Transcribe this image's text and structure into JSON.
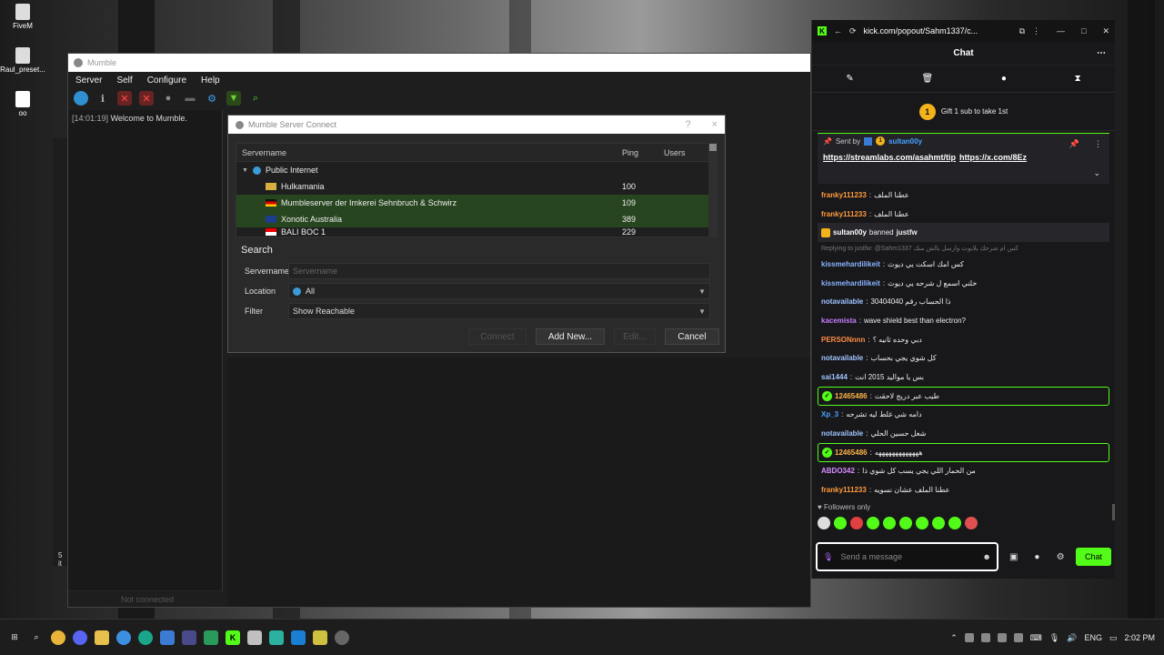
{
  "desktop": {
    "icons": [
      {
        "label": "FiveM"
      },
      {
        "label": "Raul_preset..."
      },
      {
        "label": "oo"
      }
    ]
  },
  "mumble": {
    "title": "Mumble",
    "menu": [
      "Server",
      "Self",
      "Configure",
      "Help"
    ],
    "log": {
      "timestamp": "[14:01:19]",
      "text": "Welcome to Mumble."
    },
    "status": "Not connected"
  },
  "connect_dialog": {
    "title": "Mumble Server Connect",
    "help": "?",
    "close": "×",
    "columns": {
      "name": "Servername",
      "ping": "Ping",
      "users": "Users"
    },
    "group": "Public Internet",
    "servers": [
      {
        "name": "Hulkamania",
        "ping": "100",
        "flag": "#d8b040",
        "selected": false
      },
      {
        "name": "Mumbleserver der Imkerei Sehnbruch & Schwirz",
        "ping": "109",
        "flag": "#d00000",
        "selected": true
      },
      {
        "name": "Xonotic Australia",
        "ping": "389",
        "flag": "#1c3d8c",
        "selected": true
      },
      {
        "name": "BALI BOC 1",
        "ping": "229",
        "flag": "#e00000",
        "selected": false
      }
    ],
    "search": {
      "title": "Search",
      "servername_label": "Servername",
      "servername_placeholder": "Servername",
      "location_label": "Location",
      "location_value": "All",
      "filter_label": "Filter",
      "filter_value": "Show Reachable"
    },
    "buttons": {
      "connect": "Connect",
      "add_new": "Add New...",
      "edit": "Edit...",
      "cancel": "Cancel"
    }
  },
  "left_strip": {
    "text": "5 it"
  },
  "chat": {
    "url": "kick.com/popout/Sahm1337/c...",
    "title": "Chat",
    "more": "⋯",
    "gift_text": "Gift 1 sub to take 1st",
    "gift_coin": "1",
    "pinned": {
      "sent_by_label": "Sent by",
      "sender": "sultan00y",
      "links": [
        "https://streamlabs.com/asahmt/tip",
        "https://x.com/8Ez"
      ]
    },
    "messages": [
      {
        "user": "franky111233",
        "color": "#ff9a3c",
        "text": "عطنا الملف",
        "type": "normal"
      },
      {
        "user": "franky111233",
        "color": "#ff9a3c",
        "text": "عطنا الملف",
        "type": "normal"
      },
      {
        "user": "sultan00y",
        "color": "#ffffff",
        "text": "banned",
        "target": "justfw",
        "type": "system"
      },
      {
        "user": "",
        "color": "#777777",
        "text": "Replying to justfw: @Sahm1337 كس ام شرحك يلايوت وارسل بالش منك",
        "type": "reply"
      },
      {
        "user": "kissmehardilikeit",
        "color": "#8ab4ff",
        "text": "كس امك اسكت يي ديوث",
        "type": "normal"
      },
      {
        "user": "kissmehardilikeit",
        "color": "#8ab4ff",
        "text": "خلني اسمع ل شرحه يي ديوث",
        "type": "normal"
      },
      {
        "user": "notavailable",
        "color": "#a0c4ff",
        "text": "ذا الحساب رقم 30404040",
        "type": "normal"
      },
      {
        "user": "kacemista",
        "color": "#c77dff",
        "text": "wave shield best than electron?",
        "type": "normal"
      },
      {
        "user": "PERSONnnn",
        "color": "#ff8c42",
        "text": "دبي وحده ثانيه ؟",
        "type": "normal"
      },
      {
        "user": "notavailable",
        "color": "#a0c4ff",
        "text": "كل شوي يجي بحساب",
        "type": "normal"
      },
      {
        "user": "sai1444",
        "color": "#a0c4ff",
        "text": "بس يا مواليد 2015 انت",
        "type": "normal"
      },
      {
        "user": "12465486",
        "color": "#ffb347",
        "text": "طيب عبر دريج لاحقت",
        "type": "highlight"
      },
      {
        "user": "Xp_3",
        "color": "#4aa3ff",
        "text": "دامه شي غلط ليه تشرحه",
        "type": "normal"
      },
      {
        "user": "notavailable",
        "color": "#a0c4ff",
        "text": "شغل حسين الحلي",
        "type": "normal"
      },
      {
        "user": "12465486",
        "color": "#ffb347",
        "text": "هههههههههههههه",
        "type": "highlight"
      },
      {
        "user": "ABDO342",
        "color": "#d78cff",
        "text": "من الحمار اللي يجي يسب كل شوي ذا",
        "type": "normal"
      },
      {
        "user": "franky111233",
        "color": "#ff9a3c",
        "text": "عطنا الملف عشان نسويه",
        "type": "normal"
      }
    ],
    "followers_only": "Followers only",
    "input_placeholder": "Send a message",
    "send_label": "Chat"
  },
  "taskbar": {
    "lang": "ENG",
    "time": "2:02 PM"
  },
  "colors": {
    "kick_green": "#53fc18",
    "selection_green": "#27451f",
    "gold": "#f3b31b"
  }
}
